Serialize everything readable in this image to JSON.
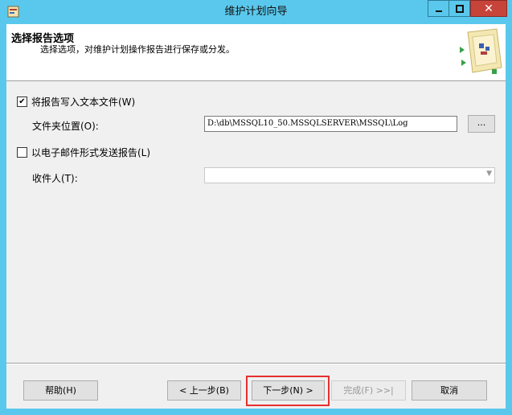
{
  "window": {
    "title": "维护计划向导"
  },
  "header": {
    "title": "选择报告选项",
    "subtitle": "选择选项，对维护计划操作报告进行保存或分发。"
  },
  "write_text": {
    "label": "将报告写入文本文件(W)",
    "checked": true,
    "checkmark": "✔"
  },
  "folder": {
    "label": "文件夹位置(O):",
    "value": "D:\\db\\MSSQL10_50.MSSQLSERVER\\MSSQL\\Log",
    "browse_label": "..."
  },
  "email": {
    "label": "以电子邮件形式发送报告(L)",
    "checked": false
  },
  "recipient": {
    "label": "收件人(T):",
    "value": ""
  },
  "buttons": {
    "help": "帮助(H)",
    "back": "< 上一步(B)",
    "next": "下一步(N) >",
    "finish": "完成(F) >>|",
    "cancel": "取消"
  },
  "titlebar": {
    "close_glyph": "✕",
    "min_glyph": "—",
    "max_glyph": "▢"
  }
}
